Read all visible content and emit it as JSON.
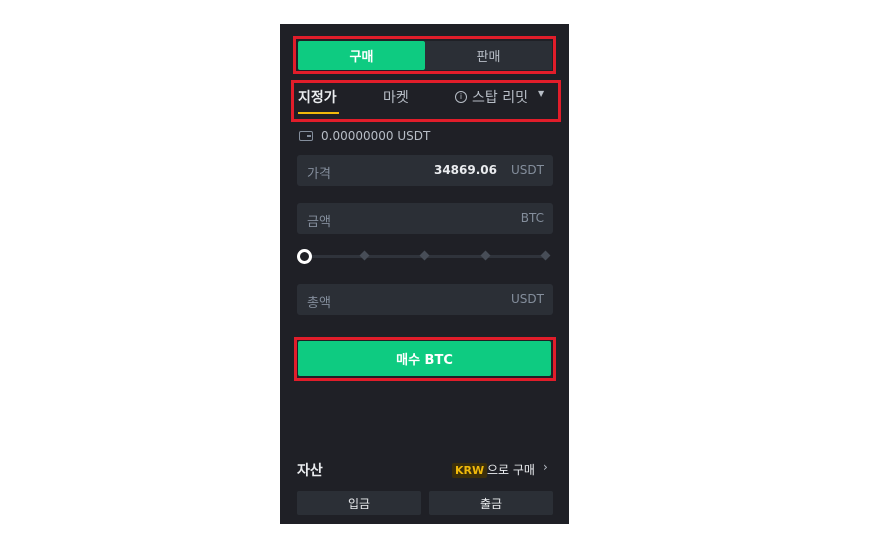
{
  "side_tabs": {
    "buy": "구매",
    "sell": "판매"
  },
  "order_types": {
    "limit": "지정가",
    "market": "마켓",
    "stop_limit": "스탑 리밋"
  },
  "balance": "0.00000000 USDT",
  "fields": {
    "price": {
      "label": "가격",
      "value": "34869.06",
      "unit": "USDT"
    },
    "amount": {
      "label": "금액",
      "unit": "BTC"
    },
    "total": {
      "label": "총액",
      "unit": "USDT"
    }
  },
  "slider": {
    "level": 0
  },
  "buy_button": "매수 BTC",
  "assets": {
    "title": "자산",
    "badge": "KRW",
    "buy_with": "으로 구매",
    "deposit": "입금",
    "withdraw": "출금"
  },
  "colors": {
    "accent_green": "#0ecb81",
    "accent_yellow": "#f0b90b",
    "highlight_red": "#e11d2a"
  }
}
